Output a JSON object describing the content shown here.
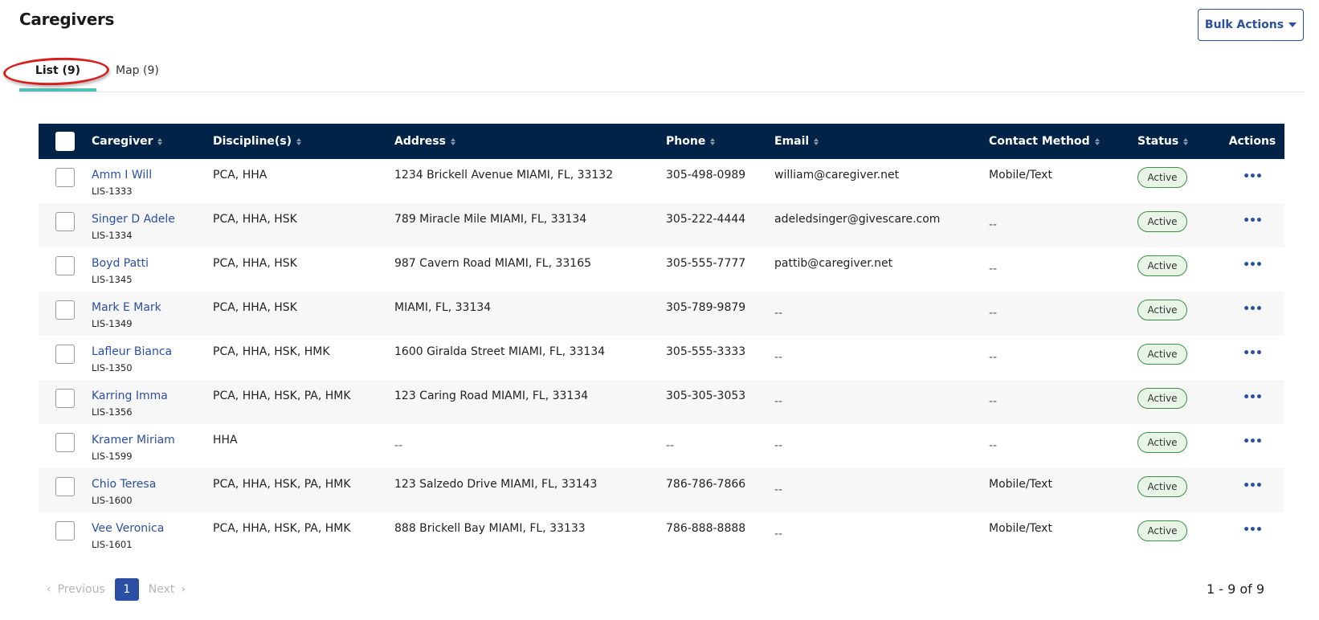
{
  "header": {
    "title": "Caregivers",
    "bulk_actions_label": "Bulk Actions"
  },
  "tabs": [
    {
      "label": "List (9)",
      "active": true
    },
    {
      "label": "Map (9)",
      "active": false
    }
  ],
  "colors": {
    "header_bg": "#012348",
    "accent": "#2a4fa3",
    "tab_underline": "#4fbfb7",
    "status_active_border": "#3e8e4a",
    "annotation": "#d91e1e"
  },
  "table": {
    "columns": [
      "Caregiver",
      "Discipline(s)",
      "Address",
      "Phone",
      "Email",
      "Contact Method",
      "Status",
      "Actions"
    ],
    "rows": [
      {
        "name": "Amm I Will",
        "id": "LIS-1333",
        "disciplines": "PCA, HHA",
        "address": "1234 Brickell Avenue MIAMI, FL, 33132",
        "phone": "305-498-0989",
        "email": "william@caregiver.net",
        "contact": "Mobile/Text",
        "status": "Active"
      },
      {
        "name": "Singer D Adele",
        "id": "LIS-1334",
        "disciplines": "PCA, HHA, HSK",
        "address": "789 Miracle Mile MIAMI, FL, 33134",
        "phone": "305-222-4444",
        "email": "adeledsinger@givescare.com",
        "contact": "--",
        "status": "Active"
      },
      {
        "name": "Boyd Patti",
        "id": "LIS-1345",
        "disciplines": "PCA, HHA, HSK",
        "address": "987 Cavern Road MIAMI, FL, 33165",
        "phone": "305-555-7777",
        "email": "pattib@caregiver.net",
        "contact": "--",
        "status": "Active"
      },
      {
        "name": "Mark E Mark",
        "id": "LIS-1349",
        "disciplines": "PCA, HHA, HSK",
        "address": "MIAMI, FL, 33134",
        "phone": "305-789-9879",
        "email": "--",
        "contact": "--",
        "status": "Active"
      },
      {
        "name": "Lafleur Bianca",
        "id": "LIS-1350",
        "disciplines": "PCA, HHA, HSK, HMK",
        "address": "1600 Giralda Street MIAMI, FL, 33134",
        "phone": "305-555-3333",
        "email": "--",
        "contact": "--",
        "status": "Active"
      },
      {
        "name": "Karring Imma",
        "id": "LIS-1356",
        "disciplines": "PCA, HHA, HSK, PA, HMK",
        "address": "123 Caring Road MIAMI, FL, 33134",
        "phone": "305-305-3053",
        "email": "--",
        "contact": "--",
        "status": "Active"
      },
      {
        "name": "Kramer Miriam",
        "id": "LIS-1599",
        "disciplines": "HHA",
        "address": "--",
        "phone": "--",
        "email": "--",
        "contact": "--",
        "status": "Active"
      },
      {
        "name": "Chio Teresa",
        "id": "LIS-1600",
        "disciplines": "PCA, HHA, HSK, PA, HMK",
        "address": "123 Salzedo Drive MIAMI, FL, 33143",
        "phone": "786-786-7866",
        "email": "--",
        "contact": "Mobile/Text",
        "status": "Active"
      },
      {
        "name": "Vee Veronica",
        "id": "LIS-1601",
        "disciplines": "PCA, HHA, HSK, PA, HMK",
        "address": "888 Brickell Bay MIAMI, FL, 33133",
        "phone": "786-888-8888",
        "email": "--",
        "contact": "Mobile/Text",
        "status": "Active"
      }
    ],
    "actions_icon": "more-horizontal-icon",
    "actions_glyph": "•••"
  },
  "pagination": {
    "previous_label": "Previous",
    "next_label": "Next",
    "current_page": "1",
    "range_label": "1 - 9 of 9",
    "prev_glyph": "‹",
    "next_glyph": "›"
  }
}
